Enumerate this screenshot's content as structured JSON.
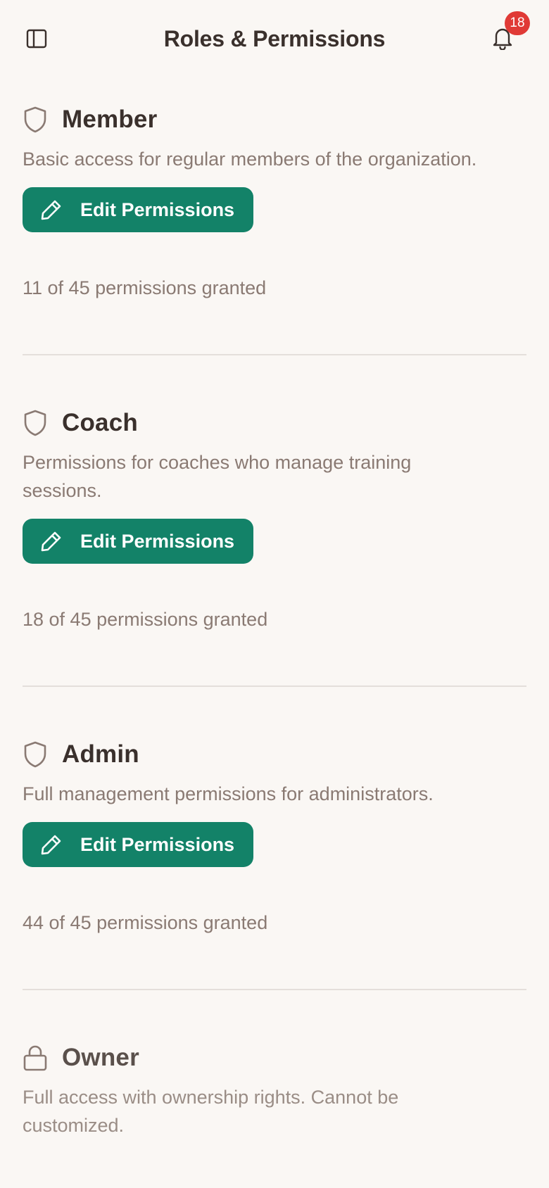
{
  "header": {
    "title": "Roles & Permissions",
    "notification_count": "18"
  },
  "roles": [
    {
      "name": "Member",
      "icon": "shield-icon",
      "description": "Basic access for regular members of the organization.",
      "button_label": "Edit Permissions",
      "granted": "11 of 45 permissions granted"
    },
    {
      "name": "Coach",
      "icon": "shield-icon",
      "description": "Permissions for coaches who manage training sessions.",
      "button_label": "Edit Permissions",
      "granted": "18 of 45 permissions granted"
    },
    {
      "name": "Admin",
      "icon": "shield-icon",
      "description": "Full management permissions for administrators.",
      "button_label": "Edit Permissions",
      "granted": "44 of 45 permissions granted"
    },
    {
      "name": "Owner",
      "icon": "lock-icon",
      "description": "Full access with ownership rights. Cannot be customized."
    }
  ],
  "colors": {
    "background": "#faf7f4",
    "accent": "#138268",
    "badge": "#e03a36",
    "text_primary": "#3a302c",
    "text_secondary": "#8a7a73"
  }
}
